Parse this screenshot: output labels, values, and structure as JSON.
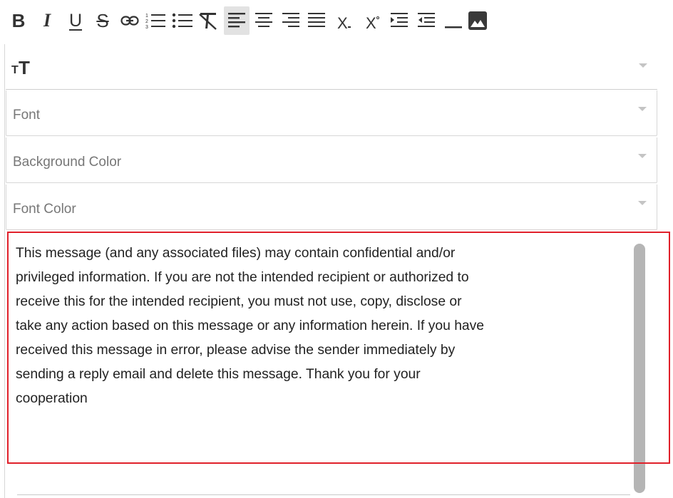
{
  "toolbar": {
    "buttons": [
      {
        "name": "bold-button",
        "icon": "bold-icon",
        "glyph": "B"
      },
      {
        "name": "italic-button",
        "icon": "italic-icon",
        "glyph": "I"
      },
      {
        "name": "underline-button",
        "icon": "underline-icon",
        "glyph": "U"
      },
      {
        "name": "strikethrough-button",
        "icon": "strikethrough-icon",
        "glyph": "S"
      },
      {
        "name": "link-button",
        "icon": "link-icon"
      },
      {
        "name": "ordered-list-button",
        "icon": "ordered-list-icon"
      },
      {
        "name": "bullet-list-button",
        "icon": "bullet-list-icon"
      },
      {
        "name": "clear-format-button",
        "icon": "clear-format-icon"
      },
      {
        "name": "align-left-button",
        "icon": "align-left-icon",
        "active": true
      },
      {
        "name": "align-center-button",
        "icon": "align-center-icon"
      },
      {
        "name": "align-right-button",
        "icon": "align-right-icon"
      },
      {
        "name": "align-justify-button",
        "icon": "align-justify-icon"
      },
      {
        "name": "subscript-button",
        "icon": "subscript-icon",
        "glyph": "X"
      },
      {
        "name": "superscript-button",
        "icon": "superscript-icon",
        "glyph": "X"
      },
      {
        "name": "indent-button",
        "icon": "indent-icon"
      },
      {
        "name": "outdent-button",
        "icon": "outdent-icon"
      },
      {
        "name": "horizontal-rule-button",
        "icon": "horizontal-rule-icon"
      },
      {
        "name": "insert-image-button",
        "icon": "image-icon"
      }
    ]
  },
  "font_size": {
    "icon": "text-size-icon",
    "glyph_small": "T",
    "glyph_big": "T"
  },
  "selects": {
    "font": {
      "label": "Font"
    },
    "background_color": {
      "label": "Background Color"
    },
    "font_color": {
      "label": "Font Color"
    }
  },
  "editor": {
    "lines": [
      "This message (and any associated files) may contain confidential and/or",
      "privileged information. If you are not the intended recipient or authorized to",
      "receive this for the intended recipient, you must not use, copy, disclose or",
      "take any action based on this message or any information herein. If you have",
      "received this message in error, please advise the sender immediately by",
      "sending a reply email and delete this message. Thank you for your",
      "cooperation"
    ]
  },
  "colors": {
    "highlight_border": "#e0202a",
    "active_button_bg": "#e2e2e2",
    "scrollbar_thumb": "#b5b5b5"
  }
}
